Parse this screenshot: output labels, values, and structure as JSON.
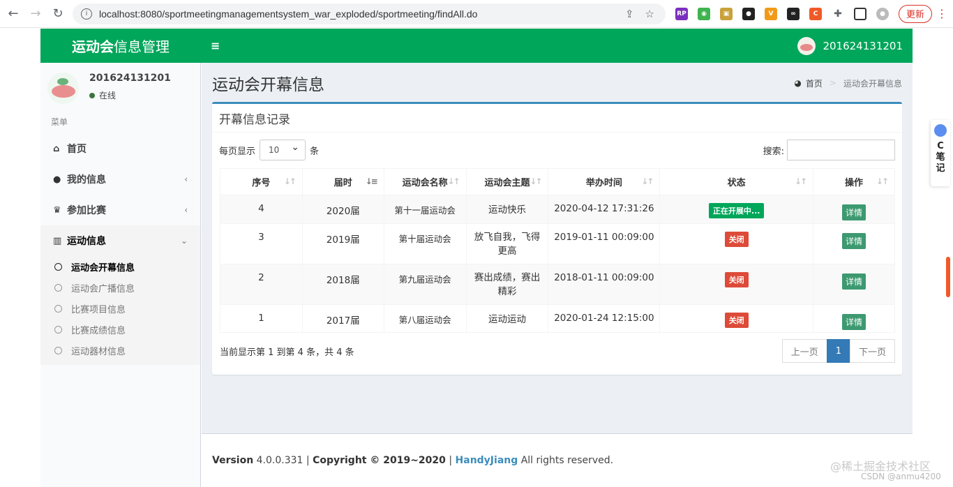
{
  "browser": {
    "url": "localhost:8080/sportmeetingmanagementsystem_war_exploded/sportmeeting/findAll.do",
    "update_label": "更新"
  },
  "header": {
    "logo_bold": "运动会",
    "logo_rest": "信息管理",
    "username": "201624131201",
    "brand_color": "#00a65a"
  },
  "sidebar": {
    "username": "201624131201",
    "status": "在线",
    "menu_header": "菜单",
    "items": [
      {
        "label": "首页",
        "icon": "home-icon"
      },
      {
        "label": "我的信息",
        "icon": "user-icon"
      },
      {
        "label": "参加比赛",
        "icon": "trophy-icon"
      },
      {
        "label": "运动信息",
        "icon": "bar-chart-icon"
      }
    ],
    "subitems": [
      {
        "label": "运动会开幕信息"
      },
      {
        "label": "运动会广播信息"
      },
      {
        "label": "比赛项目信息"
      },
      {
        "label": "比赛成绩信息"
      },
      {
        "label": "运动器材信息"
      }
    ]
  },
  "content": {
    "title": "运动会开幕信息",
    "breadcrumb": {
      "home": "首页",
      "current": "运动会开幕信息"
    },
    "box_title": "开幕信息记录",
    "page_size_prefix": "每页显示",
    "page_size_value": "10",
    "page_size_suffix": "条",
    "search_label": "搜索:",
    "columns": [
      "序号",
      "届时",
      "运动会名称",
      "运动会主题",
      "举办时间",
      "状态",
      "操作"
    ],
    "rows": [
      {
        "no": "4",
        "session": "2020届",
        "name": "第十一届运动会",
        "theme": "运动快乐",
        "time": "2020-04-12 17:31:26",
        "status": "正在开展中...",
        "action": "详情"
      },
      {
        "no": "3",
        "session": "2019届",
        "name": "第十届运动会",
        "theme": "放飞自我，飞得更高",
        "time": "2019-01-11 00:09:00",
        "status": "关闭",
        "action": "详情"
      },
      {
        "no": "2",
        "session": "2018届",
        "name": "第九届运动会",
        "theme": "赛出成绩，赛出精彩",
        "time": "2018-01-11 00:09:00",
        "status": "关闭",
        "action": "详情"
      },
      {
        "no": "1",
        "session": "2017届",
        "name": "第八届运动会",
        "theme": "运动运动",
        "time": "2020-01-24 12:15:00",
        "status": "关闭",
        "action": "详情"
      }
    ],
    "info_text": "当前显示第 1 到第 4 条，共 4 条",
    "pager": {
      "prev": "上一页",
      "current": "1",
      "next": "下一页"
    }
  },
  "footer": {
    "version_label": "Version",
    "version": "4.0.0.331",
    "copyright": "Copyright © 2019~2020",
    "brand": "HandyJiang",
    "rights": "All rights reserved."
  },
  "overlay": {
    "csdn_side": "C\n笔\n记",
    "watermark": "@稀土掘金技术社区",
    "watermark2": "CSDN @anmu4200"
  }
}
